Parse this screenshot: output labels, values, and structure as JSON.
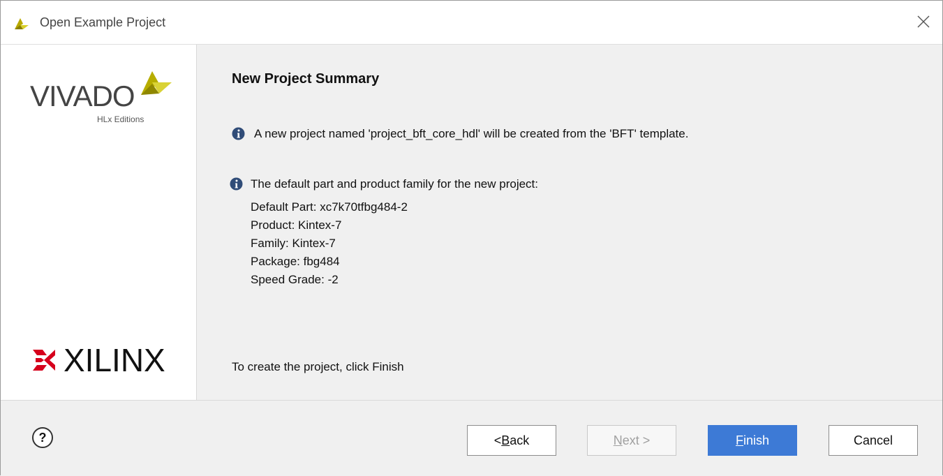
{
  "window": {
    "title": "Open Example Project"
  },
  "sidebar": {
    "vivado_logo_text": "VIVADO",
    "vivado_edition": "HLx Editions",
    "xilinx_logo_text": "XILINX"
  },
  "main": {
    "heading": "New Project Summary",
    "info1": "A new project named 'project_bft_core_hdl' will be created from the 'BFT' template.",
    "info2": "The default part and product family for the new project:",
    "details": [
      "Default Part: xc7k70tfbg484-2",
      "Product: Kintex-7",
      "Family: Kintex-7",
      "Package: fbg484",
      "Speed Grade: -2"
    ],
    "finish_hint": "To create the project, click Finish"
  },
  "footer": {
    "help_label": "?",
    "back": {
      "prefix": "< ",
      "mnemonic": "B",
      "rest": "ack"
    },
    "next": {
      "mnemonic": "N",
      "rest": "ext >"
    },
    "finish": {
      "mnemonic": "F",
      "rest": "inish"
    },
    "cancel_label": "Cancel"
  },
  "icons": {
    "app": "vivado-icon",
    "close": "close-icon",
    "info": "info-icon",
    "help": "help-icon"
  },
  "colors": {
    "primary_button": "#3d7ad6",
    "vivado_yellow": "#c8c400",
    "xilinx_red": "#d6001c"
  }
}
